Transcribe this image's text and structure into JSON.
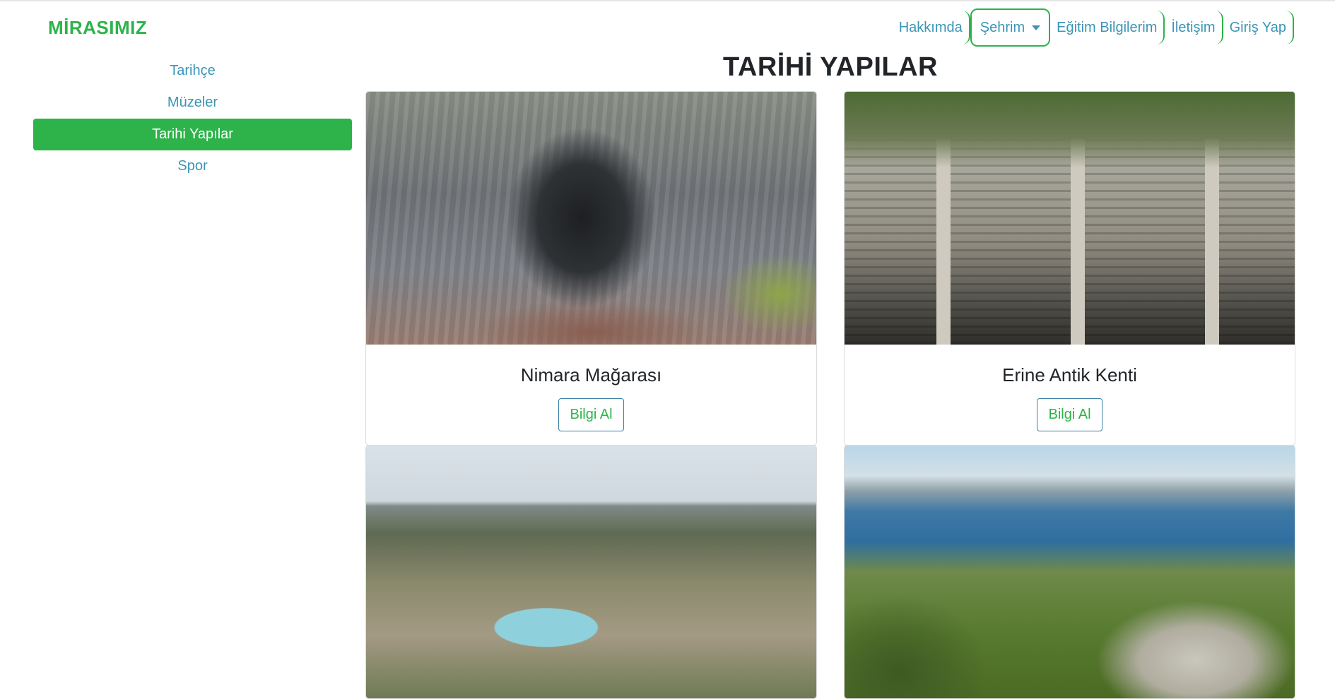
{
  "brand": "MİRASIMIZ",
  "nav": {
    "about": "Hakkımda",
    "city": "Şehrim",
    "education": "Eğitim Bilgilerim",
    "contact": "İletişim",
    "login": "Giriş Yap"
  },
  "sidebar": {
    "items": [
      {
        "label": "Tarihçe"
      },
      {
        "label": "Müzeler"
      },
      {
        "label": "Tarihi Yapılar"
      },
      {
        "label": "Spor"
      }
    ]
  },
  "main": {
    "title": "TARİHİ YAPILAR",
    "cards": [
      {
        "name": "Nimara Mağarası",
        "button": "Bilgi Al"
      },
      {
        "name": "Erine Antik Kenti",
        "button": "Bilgi Al"
      }
    ]
  },
  "colors": {
    "accent_green": "#2db34a",
    "link_blue": "#3a95b5"
  }
}
